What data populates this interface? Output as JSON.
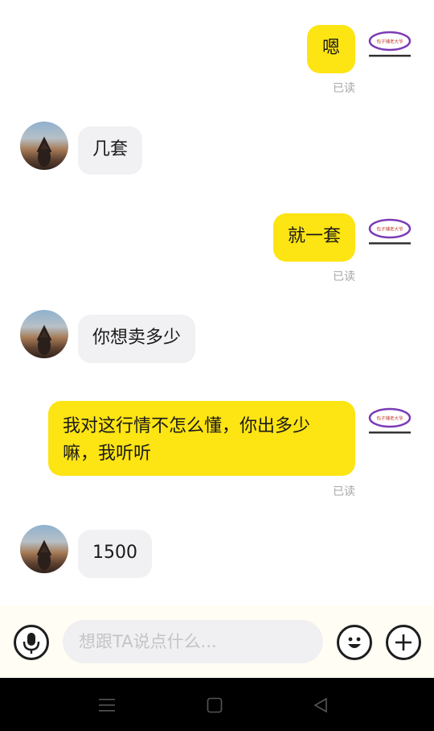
{
  "messages": [
    {
      "dir": "out",
      "text": "嗯",
      "status": "已读"
    },
    {
      "dir": "in",
      "text": "几套"
    },
    {
      "dir": "out",
      "text": "就一套",
      "status": "已读"
    },
    {
      "dir": "in",
      "text": "你想卖多少"
    },
    {
      "dir": "out",
      "text": "我对这行情不怎么懂，你出多少\n嘛，我听听",
      "status": "已读"
    },
    {
      "dir": "in",
      "text": "1500"
    }
  ],
  "self_avatar_label": "包子铺老大爷",
  "composer": {
    "placeholder": "想跟TA说点什么...",
    "mic_icon": "microphone-icon",
    "emoji_icon": "emoji-icon",
    "add_icon": "plus-icon"
  },
  "colors": {
    "outgoing_bubble": "#fde413",
    "incoming_bubble": "#f1f1f4",
    "self_avatar_ring": "#7c3bb6"
  },
  "navbar": {
    "menu_icon": "menu-icon",
    "home_icon": "home-square-icon",
    "back_icon": "back-triangle-icon"
  }
}
